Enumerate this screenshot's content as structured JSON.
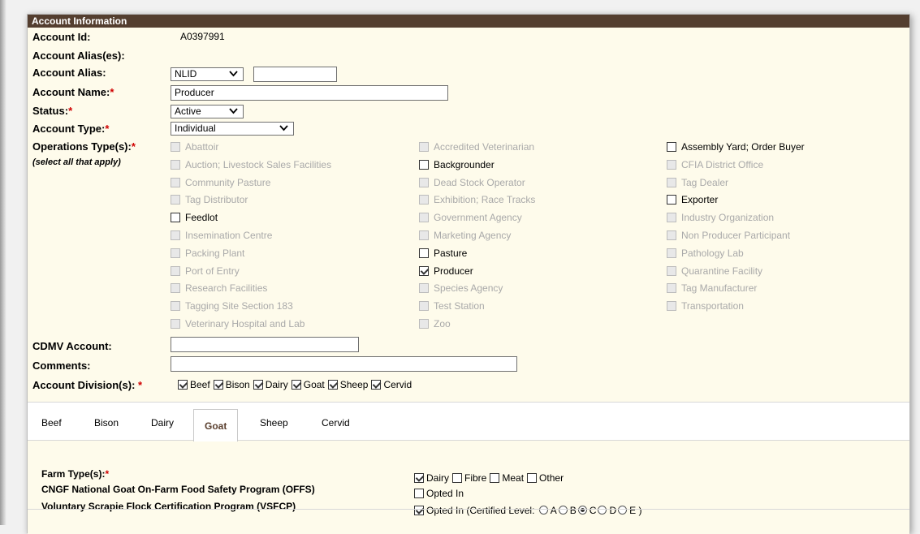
{
  "header": {
    "title": "Account Information"
  },
  "account": {
    "id_label": "Account Id:",
    "id_value": "A0397991",
    "aliases_label": "Account Alias(es):",
    "alias_label": "Account Alias:",
    "alias_type": "NLID",
    "alias_value": "",
    "name_label": "Account Name:",
    "name_value": "Producer",
    "status_label": "Status:",
    "status_value": "Active",
    "type_label": "Account Type:",
    "type_value": "Individual",
    "ops_label": "Operations Type(s):",
    "ops_note": "(select all that apply)",
    "cdmv_label": "CDMV Account:",
    "cdmv_value": "",
    "comments_label": "Comments:",
    "comments_value": "",
    "division_label": "Account Division(s):",
    "required_mark": "*"
  },
  "operations": {
    "col1": [
      {
        "label": "Abattoir",
        "enabled": false,
        "checked": false
      },
      {
        "label": "Auction; Livestock Sales Facilities",
        "enabled": false,
        "checked": false
      },
      {
        "label": "Community Pasture",
        "enabled": false,
        "checked": false
      },
      {
        "label": "Tag Distributor",
        "enabled": false,
        "checked": false
      },
      {
        "label": "Feedlot",
        "enabled": true,
        "checked": false
      },
      {
        "label": "Insemination Centre",
        "enabled": false,
        "checked": false
      },
      {
        "label": "Packing Plant",
        "enabled": false,
        "checked": false
      },
      {
        "label": "Port of Entry",
        "enabled": false,
        "checked": false
      },
      {
        "label": "Research Facilities",
        "enabled": false,
        "checked": false
      },
      {
        "label": "Tagging Site Section 183",
        "enabled": false,
        "checked": false
      },
      {
        "label": "Veterinary Hospital and Lab",
        "enabled": false,
        "checked": false
      }
    ],
    "col2": [
      {
        "label": "Accredited Veterinarian",
        "enabled": false,
        "checked": false
      },
      {
        "label": "Backgrounder",
        "enabled": true,
        "checked": false
      },
      {
        "label": "Dead Stock Operator",
        "enabled": false,
        "checked": false
      },
      {
        "label": "Exhibition; Race Tracks",
        "enabled": false,
        "checked": false
      },
      {
        "label": "Government Agency",
        "enabled": false,
        "checked": false
      },
      {
        "label": "Marketing Agency",
        "enabled": false,
        "checked": false
      },
      {
        "label": "Pasture",
        "enabled": true,
        "checked": false
      },
      {
        "label": "Producer",
        "enabled": true,
        "checked": true
      },
      {
        "label": "Species Agency",
        "enabled": false,
        "checked": false
      },
      {
        "label": "Test Station",
        "enabled": false,
        "checked": false
      },
      {
        "label": "Zoo",
        "enabled": false,
        "checked": false
      }
    ],
    "col3": [
      {
        "label": "Assembly Yard; Order Buyer",
        "enabled": true,
        "checked": false
      },
      {
        "label": "CFIA District Office",
        "enabled": false,
        "checked": false
      },
      {
        "label": "Tag Dealer",
        "enabled": false,
        "checked": false
      },
      {
        "label": "Exporter",
        "enabled": true,
        "checked": false
      },
      {
        "label": "Industry Organization",
        "enabled": false,
        "checked": false
      },
      {
        "label": "Non Producer Participant",
        "enabled": false,
        "checked": false
      },
      {
        "label": "Pathology Lab",
        "enabled": false,
        "checked": false
      },
      {
        "label": "Quarantine Facility",
        "enabled": false,
        "checked": false
      },
      {
        "label": "Tag Manufacturer",
        "enabled": false,
        "checked": false
      },
      {
        "label": "Transportation",
        "enabled": false,
        "checked": false
      }
    ]
  },
  "divisions": [
    {
      "label": "Beef",
      "checked": true
    },
    {
      "label": "Bison",
      "checked": true
    },
    {
      "label": "Dairy",
      "checked": true
    },
    {
      "label": "Goat",
      "checked": true
    },
    {
      "label": "Sheep",
      "checked": true
    },
    {
      "label": "Cervid",
      "checked": true
    }
  ],
  "tabs": [
    {
      "label": "Beef",
      "active": false
    },
    {
      "label": "Bison",
      "active": false
    },
    {
      "label": "Dairy",
      "active": false
    },
    {
      "label": "Goat",
      "active": true
    },
    {
      "label": "Sheep",
      "active": false
    },
    {
      "label": "Cervid",
      "active": false
    }
  ],
  "goat": {
    "farm_type_label": "Farm Type(s):",
    "farm_types": [
      {
        "label": "Dairy",
        "checked": true
      },
      {
        "label": "Fibre",
        "checked": false
      },
      {
        "label": "Meat",
        "checked": false
      },
      {
        "label": "Other",
        "checked": false
      }
    ],
    "offs_label": "CNGF National Goat On-Farm Food Safety Program (OFFS)",
    "offs_option": "Opted In",
    "offs_checked": false,
    "vsfcp_label": "Voluntary Scrapie Flock Certification Program (VSFCP)",
    "vsfcp_option": "Opted In (Certified Level:",
    "vsfcp_checked": true,
    "levels": [
      {
        "label": "A",
        "selected": false
      },
      {
        "label": "B",
        "selected": false
      },
      {
        "label": "C",
        "selected": true
      },
      {
        "label": "D",
        "selected": false
      },
      {
        "label": "E",
        "selected": false
      }
    ],
    "close_paren": ")"
  },
  "icons": {
    "dropdown": "chevron-down-icon"
  }
}
